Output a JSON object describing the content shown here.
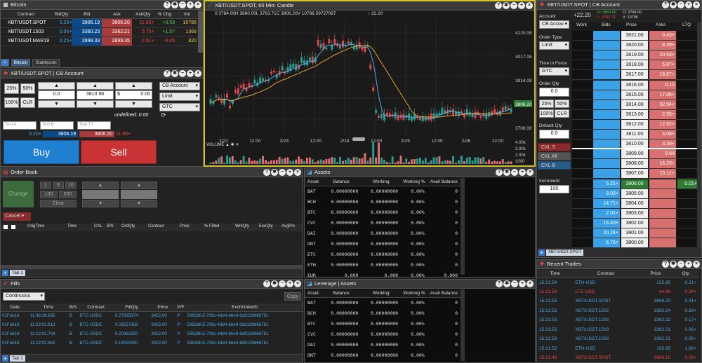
{
  "colors": {
    "bid": "#0b4a8a",
    "ask": "#a83a3a",
    "accent": "#d4c42a",
    "up": "#2a9d8f",
    "down": "#e04848"
  },
  "watchlist": {
    "title": "Bitcoin",
    "columns": [
      "Contract",
      "BidQty",
      "Bid",
      "Ask",
      "AskQty",
      "% Chg",
      "Vol"
    ],
    "rows": [
      {
        "contract": "XBT/USDT.SPOT",
        "bidqty": "5.20+",
        "bid": "3806.19",
        "ask": "3806.20",
        "askqty": "11.60+",
        "chg": "+0.59",
        "vol": "10786"
      },
      {
        "contract": "XBT/USDT.1503",
        "bidqty": "0.06+",
        "bid": "3360.23",
        "ask": "3362.21",
        "askqty": "5.75+",
        "chg": "+1.57",
        "vol": "1368"
      },
      {
        "contract": "XBT/USDT.MAR19",
        "bidqty": "0.25+",
        "bid": "2899.33",
        "ask": "2899.35",
        "askqty": "2.81+",
        "chg": "-0.05",
        "vol": "820"
      }
    ],
    "tabs": [
      "Bitcoin",
      "Stablecoin"
    ]
  },
  "ticket": {
    "title": "XBT/USDT.SPOT | CB Account",
    "qty_buttons": [
      "25%",
      "50%",
      "100%",
      "CLR"
    ],
    "qty": "0.0",
    "price": "3810.98",
    "dollar_prefix": "$",
    "amount": "0.00",
    "account": "CB Account",
    "order_type": "Limit",
    "tif": "GTC",
    "undefined_label": "undefined: 0.00",
    "text_placeholders": [
      "Text A",
      "Text B",
      "Text TT"
    ],
    "bidqty": "5.20+",
    "bid": "3806.19",
    "ask": "3806.20",
    "askqty": "11.60+",
    "buy": "Buy",
    "sell": "Sell"
  },
  "chart": {
    "title": "XBT/USDT.SPOT, 60 Min: Candle",
    "ohlc": "0 3784.00H 3860.00L 3763.71C 3806.20V 10786.59727087",
    "change": "↑ 22.20",
    "y_ticks": [
      "4120.08",
      "4017.08",
      "3914.08",
      "3811.08",
      "3708.08"
    ],
    "last_price": "3806.20",
    "x_ticks": [
      "2/22",
      "12:00",
      "2/23",
      "12:00",
      "2/24",
      "12:00",
      "2/25",
      "12:00",
      "2/26",
      "12:00"
    ],
    "volume_label": "VOLUME",
    "vol_ticks": [
      "4.00k",
      "3.00k",
      "2.00k",
      "1000"
    ]
  },
  "dom": {
    "title": "XBT/USDT.SPOT | CB Account",
    "account_label": "Account",
    "change": "+22.20",
    "hl": {
      "h": "H: 3860.00",
      "l": "L: 3763.71",
      "o": "O: 3784.00",
      "v": "V: 10786"
    },
    "account_value": "CB Accou",
    "order_type_label": "Order Type",
    "order_type": "Limit",
    "tif_label": "Time in Force",
    "tif": "GTC",
    "order_qty_label": "Order Qty",
    "order_qty": "0.0",
    "qty_buttons": [
      "25%",
      "50%",
      "100%",
      "CLR"
    ],
    "default_qty_label": "Default Qty",
    "default_qty": "0.0",
    "cxl_s": "CXL S",
    "cxl_all": "CXL All",
    "cxl_b": "CXL B",
    "increment_label": "Increment",
    "increment": "100",
    "columns": [
      "Work",
      "Bids",
      "Price",
      "Asks",
      "LTQ"
    ],
    "rows": [
      {
        "bid": "",
        "price": "3821.00",
        "ask": "0.43+",
        "ltq": ""
      },
      {
        "bid": "",
        "price": "3820.00",
        "ask": "8.39+",
        "ltq": ""
      },
      {
        "bid": "",
        "price": "3819.00",
        "ask": "20.53+",
        "ltq": ""
      },
      {
        "bid": "",
        "price": "3818.00",
        "ask": "5.87+",
        "ltq": ""
      },
      {
        "bid": "",
        "price": "3817.00",
        "ask": "16.67+",
        "ltq": ""
      },
      {
        "bid": "",
        "price": "3816.00",
        "ask": "0.10",
        "ltq": ""
      },
      {
        "bid": "",
        "price": "3815.00",
        "ask": "17.06+",
        "ltq": ""
      },
      {
        "bid": "",
        "price": "3814.00",
        "ask": "32.94+",
        "ltq": ""
      },
      {
        "bid": "",
        "price": "3813.00",
        "ask": "2.55+",
        "ltq": ""
      },
      {
        "bid": "",
        "price": "3812.00",
        "ask": "12.62+",
        "ltq": ""
      },
      {
        "bid": "",
        "price": "3811.00",
        "ask": "3.08+",
        "ltq": ""
      },
      {
        "bid": "",
        "price": "3810.00",
        "ask": "3.39+",
        "ltq": ""
      },
      {
        "bid": "",
        "price": "3809.00",
        "ask": "9.64",
        "ltq": ""
      },
      {
        "bid": "",
        "price": "3808.00",
        "ask": "16.20+",
        "ltq": ""
      },
      {
        "bid": "",
        "price": "3807.00",
        "ask": "15.11+",
        "ltq": ""
      },
      {
        "bid": "6.21+",
        "price": "3806.00",
        "ask": "",
        "ltq": "0.01+"
      },
      {
        "bid": "8.00+",
        "price": "3805.00",
        "ask": "",
        "ltq": ""
      },
      {
        "bid": "14.71+",
        "price": "3804.00",
        "ask": "",
        "ltq": ""
      },
      {
        "bid": "2.01+",
        "price": "3803.00",
        "ask": "",
        "ltq": ""
      },
      {
        "bid": "16.40+",
        "price": "3802.00",
        "ask": "",
        "ltq": ""
      },
      {
        "bid": "20.24+",
        "price": "3801.00",
        "ask": "",
        "ltq": ""
      },
      {
        "bid": "6.76+",
        "price": "3800.00",
        "ask": "",
        "ltq": ""
      }
    ],
    "tab": "XBT/USDT.SPOT"
  },
  "order_book": {
    "title": "Order Book",
    "change": "Change",
    "qty": [
      "1",
      "5",
      "10",
      "100",
      "500"
    ],
    "clear": "Clear",
    "cancel": "Cancel",
    "columns": [
      "",
      "",
      "OrigTime",
      "Time",
      "CXL",
      "B/S",
      "OrdQty",
      "Contract",
      "Price",
      "% Filled",
      "WrkQty",
      "ExeQty",
      "AvgPrc"
    ],
    "tab": "Tab 1"
  },
  "assets": {
    "title": "Assets",
    "columns": [
      "Asset",
      "Balance",
      "Working",
      "Working %",
      "Avail Balance"
    ],
    "rows": [
      [
        "BAT",
        "0.00000000",
        "0.00000000",
        "0.00%",
        "0"
      ],
      [
        "BCH",
        "0.00000000",
        "0.00000000",
        "0.00%",
        "0"
      ],
      [
        "BTC",
        "0.00000000",
        "0.00000000",
        "0.00%",
        "0"
      ],
      [
        "CVC",
        "0.00000000",
        "0.00000000",
        "0.00%",
        "0"
      ],
      [
        "DAI",
        "0.00000000",
        "0.00000000",
        "0.00%",
        "0"
      ],
      [
        "DNT",
        "0.00000000",
        "0.00000000",
        "0.00%",
        "0"
      ],
      [
        "ETC",
        "0.00000000",
        "0.00000000",
        "0.00%",
        "0"
      ],
      [
        "ETH",
        "0.00000000",
        "0.00000000",
        "0.00%",
        "0"
      ],
      [
        "EUR",
        "0.000",
        "0.000",
        "0.00%",
        "0.000"
      ]
    ]
  },
  "fills": {
    "title": "Fills",
    "mode": "Continuous",
    "copy": "Copy",
    "columns": [
      "Date",
      "Time",
      "B/S",
      "Contract",
      "FillQty",
      "Price",
      "P/F",
      "ExchOrderID"
    ],
    "rows": [
      [
        "01Feb19",
        "11:48:36.695",
        "B",
        "BTC-USDC",
        "0.27835374",
        "3422.00",
        "P",
        "5962bfc5-708c-4dd4-b6e9-6d8139666781"
      ],
      [
        "01Feb19",
        "11:22:02.812",
        "B",
        "BTC-USDC",
        "0.03527958",
        "3422.00",
        "P",
        "5962bfc5-708c-4dd4-b6e9-6d8139666781"
      ],
      [
        "01Feb19",
        "11:22:02.764",
        "B",
        "BTC-USDC",
        "0.20963250",
        "3422.00",
        "P",
        "5962bfc5-708c-4dd4-b6e9-6d8139666781"
      ],
      [
        "01Feb19",
        "11:22:02.662",
        "B",
        "BTC-USDC",
        "0.13059490",
        "3422.00",
        "P",
        "5962bfc5-708c-4dd4-b6e9-6d8139666781"
      ]
    ],
    "tab": "Tab 1"
  },
  "leverage": {
    "title": "Leverage | Assets",
    "columns": [
      "Asset",
      "Balance",
      "Working",
      "Working %",
      "Avail Balance"
    ],
    "rows": [
      [
        "BAT",
        "0.00000000",
        "0.00000000",
        "0.00%",
        "0"
      ],
      [
        "BCH",
        "0.00000000",
        "0.00000000",
        "0.00%",
        "0"
      ],
      [
        "BTC",
        "0.00000000",
        "0.00000000",
        "0.00%",
        "0"
      ],
      [
        "CVC",
        "0.00000000",
        "0.00000000",
        "0.00%",
        "0"
      ],
      [
        "DAI",
        "0.00000000",
        "0.00000000",
        "0.00%",
        "0"
      ],
      [
        "DNT",
        "0.00000000",
        "0.00000000",
        "0.00%",
        "0"
      ]
    ]
  },
  "recent": {
    "title": "Recent Trades",
    "columns": [
      "Time",
      "Contract",
      "Price",
      "Qty"
    ],
    "rows": [
      {
        "time": "15:21:54",
        "contract": "ETH-USD",
        "price": "135.95",
        "qty": "0.21+",
        "side": "b"
      },
      {
        "time": "15:21:54",
        "contract": "LTC-USD",
        "price": "44.88",
        "qty": "0.34+",
        "side": "s"
      },
      {
        "time": "15:21:53",
        "contract": "XBT/USDT.SPOT",
        "price": "3806.20",
        "qty": "0.01+",
        "side": "b"
      },
      {
        "time": "15:21:53",
        "contract": "XBT/USDT.1503",
        "price": "3362.24",
        "qty": "0.83+",
        "side": "b"
      },
      {
        "time": "15:21:53",
        "contract": "XBT/USDT.1503",
        "price": "3362.22",
        "qty": "0.17+",
        "side": "b"
      },
      {
        "time": "15:21:53",
        "contract": "XBT/USDT.1503",
        "price": "3362.21",
        "qty": "0.06+",
        "side": "b"
      },
      {
        "time": "15:21:53",
        "contract": "XBT/USDT.1503",
        "price": "3362.21",
        "qty": "0.05+",
        "side": "b"
      },
      {
        "time": "15:21:52",
        "contract": "ETH-USD",
        "price": "135.95",
        "qty": "1.68+",
        "side": "b"
      },
      {
        "time": "15:21:48",
        "contract": "XBT/USDT.SPOT",
        "price": "3806.10",
        "qty": "0.09+",
        "side": "s"
      }
    ]
  }
}
